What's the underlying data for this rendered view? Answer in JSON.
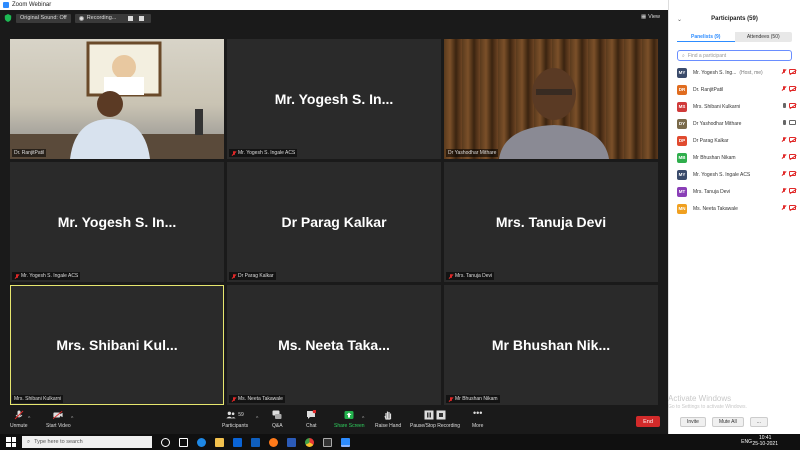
{
  "window": {
    "title": "Zoom Webinar"
  },
  "top_strip": {
    "sound_chip": "Original Sound: Off",
    "recording_label": "Recording...",
    "view_label": "View"
  },
  "tiles": [
    {
      "id": "ranjit",
      "big_name": "",
      "label": "Dr. RanjitPatil",
      "muted": false
    },
    {
      "id": "yogesh1",
      "big_name": "Mr. Yogesh S. In...",
      "label": "Mr. Yogesh S. Ingale ACS",
      "muted": true
    },
    {
      "id": "yashodhar",
      "big_name": "",
      "label": "Dr Yashodhar Mithare",
      "muted": false
    },
    {
      "id": "yogesh2",
      "big_name": "Mr. Yogesh S. In...",
      "label": "Mr. Yogesh S. Ingale ACS",
      "muted": true
    },
    {
      "id": "parag",
      "big_name": "Dr Parag Kalkar",
      "label": "Dr Parag Kalkar",
      "muted": true
    },
    {
      "id": "tanuja",
      "big_name": "Mrs. Tanuja Devi",
      "label": "Mrs. Tanuja Devi",
      "muted": true
    },
    {
      "id": "shibani",
      "big_name": "Mrs. Shibani Kul...",
      "label": "Mrs. Shibani Kulkarni",
      "muted": false
    },
    {
      "id": "neeta",
      "big_name": "Ms. Neeta Taka...",
      "label": "Ms. Neeta Takawale",
      "muted": true
    },
    {
      "id": "bhushan",
      "big_name": "Mr Bhushan Nik...",
      "label": "Mr Bhushan Nikam",
      "muted": true
    }
  ],
  "toolbar": {
    "unmute": "Unmute",
    "start_video": "Start Video",
    "participants": "Participants",
    "participants_count": "59",
    "qa": "Q&A",
    "chat": "Chat",
    "share_screen": "Share Screen",
    "raise_hand": "Raise Hand",
    "pause_recording": "Pause/Stop Recording",
    "more": "More",
    "end": "End"
  },
  "panel": {
    "title": "Participants (59)",
    "tab_panelists": "Panelists (9)",
    "tab_attendees": "Attendees (50)",
    "search_placeholder": "Find a participant",
    "participants": [
      {
        "initials": "MY",
        "name": "Mr. Yogesh S. Ing...",
        "host": "(Host, me)",
        "color": "#3a4b6b",
        "mic": "off",
        "video": "off"
      },
      {
        "initials": "DR",
        "name": "Dr. RanjitPatil",
        "host": "",
        "color": "#e06c1f",
        "mic": "off",
        "video": "off"
      },
      {
        "initials": "MS",
        "name": "Mrs. Shibani Kulkarni",
        "host": "",
        "color": "#d03a3a",
        "mic": "on",
        "video": "off"
      },
      {
        "initials": "DY",
        "name": "Dr Yashodhar Mithare",
        "host": "",
        "color": "#7a6a4a",
        "mic": "on",
        "video": "on"
      },
      {
        "initials": "DP",
        "name": "Dr Parag Kalkar",
        "host": "",
        "color": "#e04a2f",
        "mic": "off",
        "video": "off"
      },
      {
        "initials": "MB",
        "name": "Mr Bhushan Nikam",
        "host": "",
        "color": "#2fae4c",
        "mic": "off",
        "video": "off"
      },
      {
        "initials": "MY",
        "name": "Mr. Yogesh S. Ingale ACS",
        "host": "",
        "color": "#3a4b6b",
        "mic": "off",
        "video": "off"
      },
      {
        "initials": "MT",
        "name": "Mrs. Tanuja Devi",
        "host": "",
        "color": "#8a3fb7",
        "mic": "off",
        "video": "off"
      },
      {
        "initials": "MN",
        "name": "Ms. Neeta Takawale",
        "host": "",
        "color": "#f0a020",
        "mic": "off",
        "video": "off"
      }
    ],
    "invite": "Invite",
    "mute_all": "Mute All",
    "more": "..."
  },
  "watermark": {
    "line1": "Activate Windows",
    "line2": "Go to Settings to activate Windows."
  },
  "taskbar": {
    "search_placeholder": "Type here to search",
    "lang": "ENG",
    "time": "10:41",
    "date": "25-10-2021"
  },
  "colors": {
    "end_red": "#d22a2a",
    "accent_blue": "#2d8cff",
    "active_speaker": "#e6e66e"
  }
}
